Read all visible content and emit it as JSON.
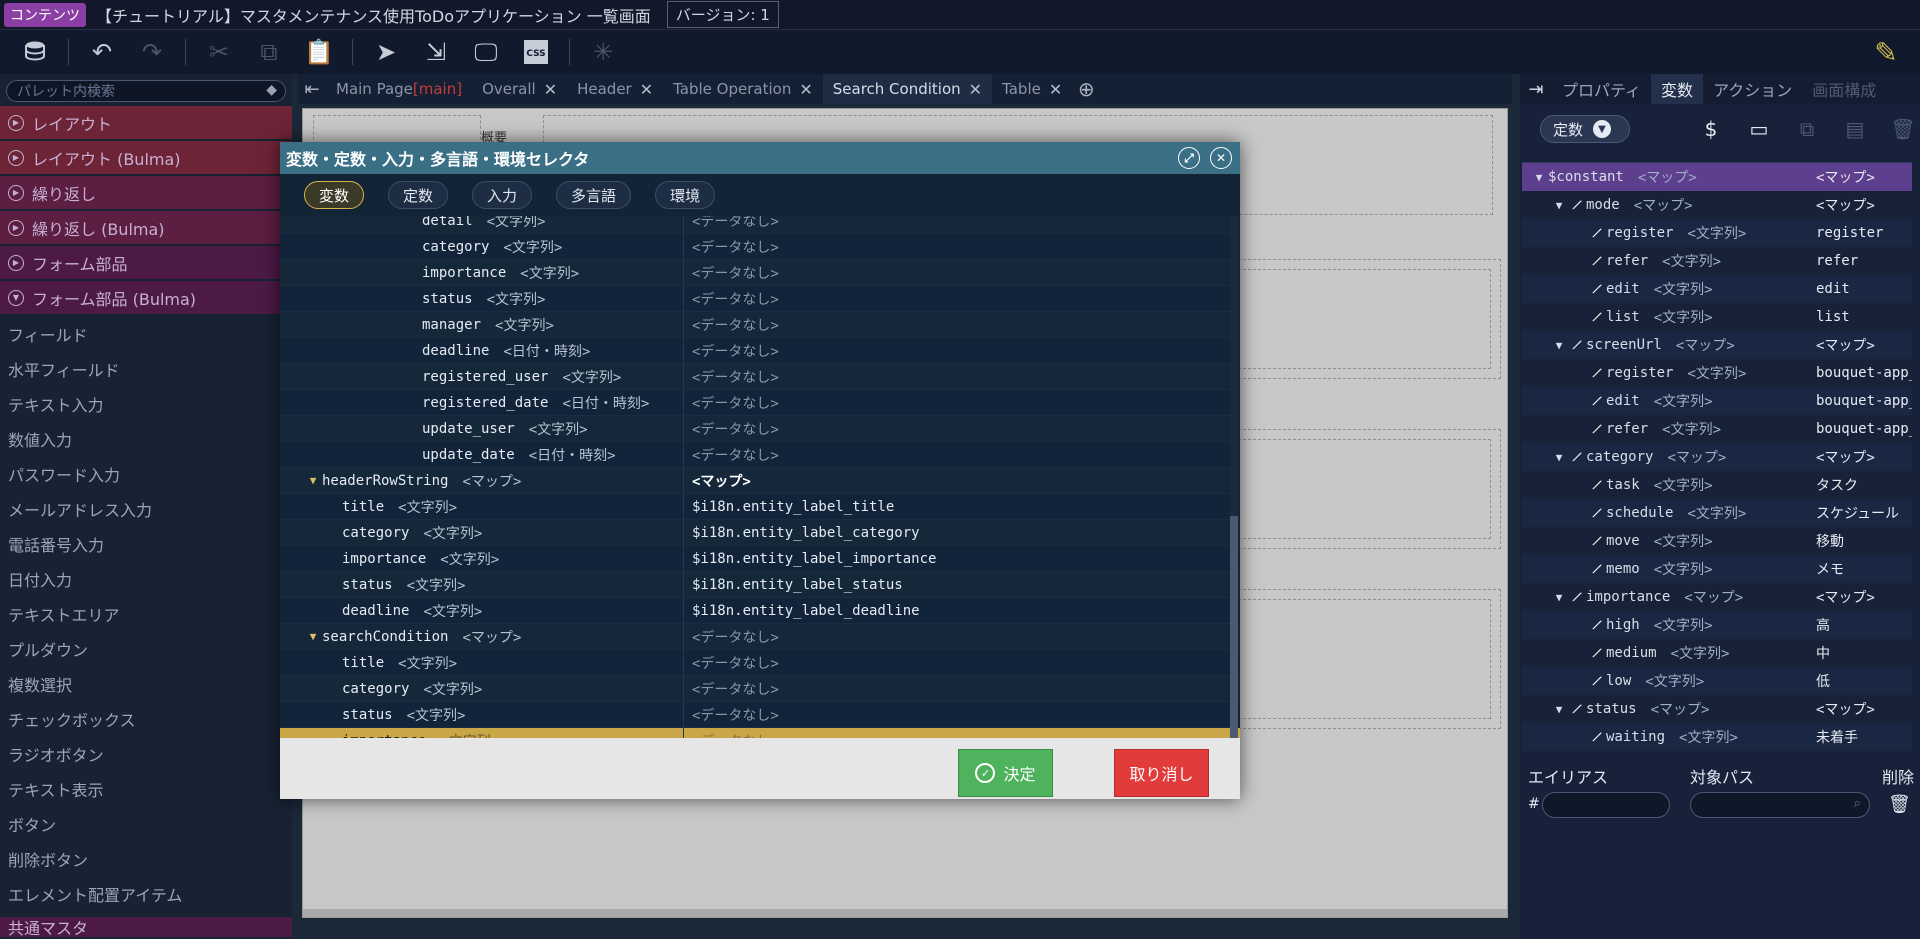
{
  "titlebar": {
    "badge": "コンテンツ",
    "title": "【チュートリアル】マスタメンテナンス使用ToDoアプリケーション 一覧画面",
    "version": "バージョン: 1"
  },
  "toolbar": {
    "icons": [
      "database-icon",
      "undo-icon",
      "redo-icon",
      "cut-icon",
      "copy-icon",
      "paste-icon",
      "pointer-icon",
      "flow-icon",
      "monitor-icon",
      "css-icon",
      "sparkle-icon"
    ],
    "css_label": "CSS"
  },
  "palette": {
    "search_placeholder": "パレット内検索",
    "categories": [
      "レイアウト",
      "レイアウト (Bulma)",
      "繰り返し",
      "繰り返し (Bulma)",
      "フォーム部品",
      "フォーム部品 (Bulma)"
    ],
    "items": [
      "フィールド",
      "水平フィールド",
      "テキスト入力",
      "数値入力",
      "パスワード入力",
      "メールアドレス入力",
      "電話番号入力",
      "日付入力",
      "テキストエリア",
      "プルダウン",
      "複数選択",
      "チェックボックス",
      "ラジオボタン",
      "テキスト表示",
      "ボタン",
      "削除ボタン",
      "エレメント配置アイテム"
    ],
    "last_category": "共通マスタ"
  },
  "editor": {
    "tabs": [
      {
        "label": "Main Page",
        "tag": "[main]"
      },
      {
        "label": "Overall"
      },
      {
        "label": "Header"
      },
      {
        "label": "Table Operation"
      },
      {
        "label": "Search Condition",
        "active": true
      },
      {
        "label": "Table"
      }
    ],
    "overview_label": "概要"
  },
  "right_panel": {
    "tabs": [
      "プロパティ",
      "変数",
      "アクション",
      "画面構成"
    ],
    "active_tab": "変数",
    "scope": "定数",
    "tree": [
      {
        "indent": 0,
        "twisty": true,
        "key": "$constant",
        "type": "<マップ>",
        "value": "<マップ>",
        "selected": true
      },
      {
        "indent": 1,
        "twisty": true,
        "pen": true,
        "key": "mode",
        "type": "<マップ>",
        "value": "<マップ>"
      },
      {
        "indent": 2,
        "pen": true,
        "key": "register",
        "type": "<文字列>",
        "value": "register"
      },
      {
        "indent": 2,
        "pen": true,
        "key": "refer",
        "type": "<文字列>",
        "value": "refer"
      },
      {
        "indent": 2,
        "pen": true,
        "key": "edit",
        "type": "<文字列>",
        "value": "edit"
      },
      {
        "indent": 2,
        "pen": true,
        "key": "list",
        "type": "<文字列>",
        "value": "list"
      },
      {
        "indent": 1,
        "twisty": true,
        "pen": true,
        "key": "screenUrl",
        "type": "<マップ>",
        "value": "<マップ>"
      },
      {
        "indent": 2,
        "pen": true,
        "key": "register",
        "type": "<文字列>",
        "value": "bouquet-app_"
      },
      {
        "indent": 2,
        "pen": true,
        "key": "edit",
        "type": "<文字列>",
        "value": "bouquet-app_"
      },
      {
        "indent": 2,
        "pen": true,
        "key": "refer",
        "type": "<文字列>",
        "value": "bouquet-app_"
      },
      {
        "indent": 1,
        "twisty": true,
        "pen": true,
        "key": "category",
        "type": "<マップ>",
        "value": "<マップ>"
      },
      {
        "indent": 2,
        "pen": true,
        "key": "task",
        "type": "<文字列>",
        "value": "タスク"
      },
      {
        "indent": 2,
        "pen": true,
        "key": "schedule",
        "type": "<文字列>",
        "value": "スケジュール"
      },
      {
        "indent": 2,
        "pen": true,
        "key": "move",
        "type": "<文字列>",
        "value": "移動"
      },
      {
        "indent": 2,
        "pen": true,
        "key": "memo",
        "type": "<文字列>",
        "value": "メモ"
      },
      {
        "indent": 1,
        "twisty": true,
        "pen": true,
        "key": "importance",
        "type": "<マップ>",
        "value": "<マップ>"
      },
      {
        "indent": 2,
        "pen": true,
        "key": "high",
        "type": "<文字列>",
        "value": "高"
      },
      {
        "indent": 2,
        "pen": true,
        "key": "medium",
        "type": "<文字列>",
        "value": "中"
      },
      {
        "indent": 2,
        "pen": true,
        "key": "low",
        "type": "<文字列>",
        "value": "低"
      },
      {
        "indent": 1,
        "twisty": true,
        "pen": true,
        "key": "status",
        "type": "<マップ>",
        "value": "<マップ>"
      },
      {
        "indent": 2,
        "pen": true,
        "key": "waiting",
        "type": "<文字列>",
        "value": "未着手"
      }
    ],
    "alias_header": "エイリアス",
    "path_header": "対象パス",
    "delete_header": "削除",
    "hash": "#"
  },
  "dialog": {
    "title": "変数・定数・入力・多言語・環境セレクタ",
    "tabs": [
      "変数",
      "定数",
      "入力",
      "多言語",
      "環境"
    ],
    "active_tab": "変数",
    "rows": [
      {
        "indent": 2,
        "key": "detail",
        "type": "<文字列>",
        "value": "<データなし>",
        "none": true
      },
      {
        "indent": 2,
        "key": "category",
        "type": "<文字列>",
        "value": "<データなし>",
        "none": true
      },
      {
        "indent": 2,
        "key": "importance",
        "type": "<文字列>",
        "value": "<データなし>",
        "none": true
      },
      {
        "indent": 2,
        "key": "status",
        "type": "<文字列>",
        "value": "<データなし>",
        "none": true
      },
      {
        "indent": 2,
        "key": "manager",
        "type": "<文字列>",
        "value": "<データなし>",
        "none": true
      },
      {
        "indent": 2,
        "key": "deadline",
        "type": "<日付・時刻>",
        "value": "<データなし>",
        "none": true
      },
      {
        "indent": 2,
        "key": "registered_user",
        "type": "<文字列>",
        "value": "<データなし>",
        "none": true
      },
      {
        "indent": 2,
        "key": "registered_date",
        "type": "<日付・時刻>",
        "value": "<データなし>",
        "none": true
      },
      {
        "indent": 2,
        "key": "update_user",
        "type": "<文字列>",
        "value": "<データなし>",
        "none": true
      },
      {
        "indent": 2,
        "key": "update_date",
        "type": "<日付・時刻>",
        "value": "<データなし>",
        "none": true
      },
      {
        "indent": 0,
        "twisty": true,
        "key": "headerRowString",
        "type": "<マップ>",
        "value": "<マップ>",
        "map": true
      },
      {
        "indent": 1,
        "key": "title",
        "type": "<文字列>",
        "value": "$i18n.entity_label_title"
      },
      {
        "indent": 1,
        "key": "category",
        "type": "<文字列>",
        "value": "$i18n.entity_label_category"
      },
      {
        "indent": 1,
        "key": "importance",
        "type": "<文字列>",
        "value": "$i18n.entity_label_importance"
      },
      {
        "indent": 1,
        "key": "status",
        "type": "<文字列>",
        "value": "$i18n.entity_label_status"
      },
      {
        "indent": 1,
        "key": "deadline",
        "type": "<文字列>",
        "value": "$i18n.entity_label_deadline"
      },
      {
        "indent": 0,
        "twisty": true,
        "key": "searchCondition",
        "type": "<マップ>",
        "value": "<データなし>",
        "none": true
      },
      {
        "indent": 1,
        "key": "title",
        "type": "<文字列>",
        "value": "<データなし>",
        "none": true
      },
      {
        "indent": 1,
        "key": "category",
        "type": "<文字列>",
        "value": "<データなし>",
        "none": true
      },
      {
        "indent": 1,
        "key": "status",
        "type": "<文字列>",
        "value": "<データなし>",
        "none": true
      },
      {
        "indent": 1,
        "key": "importance",
        "type": "<文字列>",
        "value": "<データなし>",
        "none": true,
        "selected": true
      }
    ],
    "ok_label": "決定",
    "cancel_label": "取り消し"
  },
  "colors": {
    "accent_purple": "#8b3fa5",
    "selected_row": "#c9a646",
    "ok_green": "#4fb35d",
    "cancel_red": "#e23b3b",
    "dialog_header": "#3a6f86"
  }
}
